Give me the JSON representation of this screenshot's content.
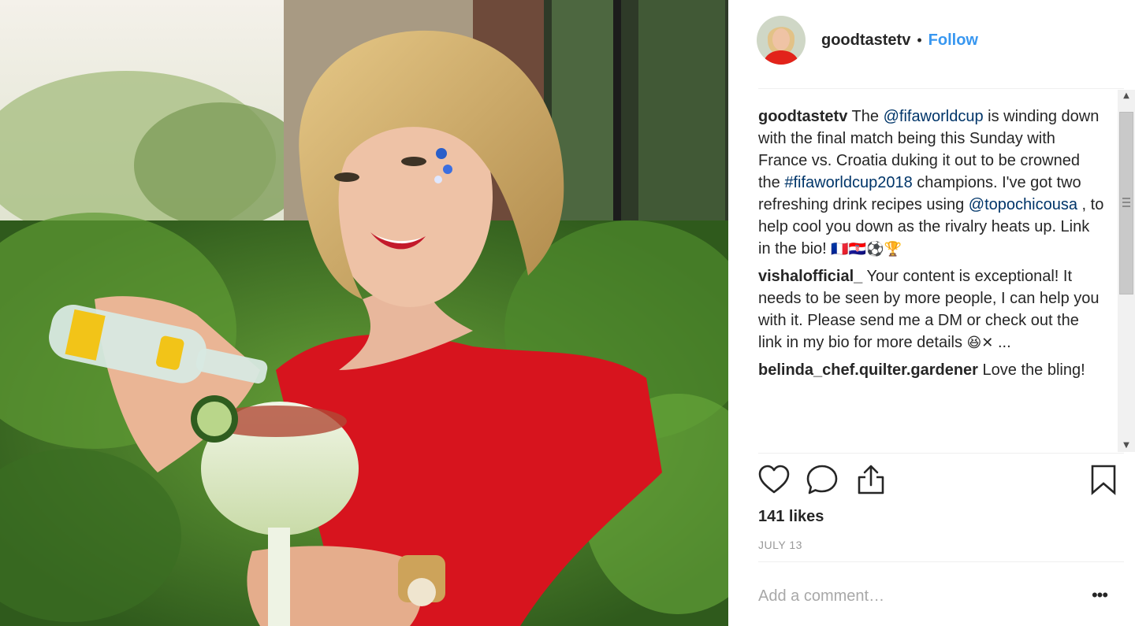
{
  "post": {
    "username": "goodtastetv",
    "separator": "•",
    "follow_label": "Follow",
    "caption": {
      "user": "goodtastetv",
      "parts": {
        "t1": "The ",
        "mention1": "@fifaworldcup",
        "t2": " is winding down with the final match being this Sunday with France vs. Croatia duking it out to be crowned the ",
        "hashtag1": "#fifaworldcup2018",
        "t3": " champions. I've got two refreshing drink recipes using ",
        "mention2": "@topochicousa",
        "t4": " , to help cool you down as the rivalry heats up. Link in the bio! ",
        "emoji": "🇫🇷🇭🇷⚽🏆"
      }
    },
    "comments": [
      {
        "user": "vishalofficial_",
        "text": "Your content is exceptional! It needs to be seen by more people, I can help you with it. Please send me a DM or check out the link in my bio for more details ",
        "emoji": "😆✕",
        "more": " ..."
      },
      {
        "user": "belinda_chef.quilter.gardener",
        "text": "Love the bling!"
      }
    ],
    "likes": "141 likes",
    "date": "JULY 13",
    "comment_placeholder": "Add a comment…",
    "more_label": "•••"
  },
  "icons": {
    "like": "heart-icon",
    "comment": "comment-icon",
    "share": "share-icon",
    "save": "bookmark-icon",
    "more": "more-options-icon"
  },
  "colors": {
    "accent": "#3897f0",
    "link": "#003569",
    "text": "#262626",
    "muted": "#999999",
    "dress": "#d7141e"
  }
}
